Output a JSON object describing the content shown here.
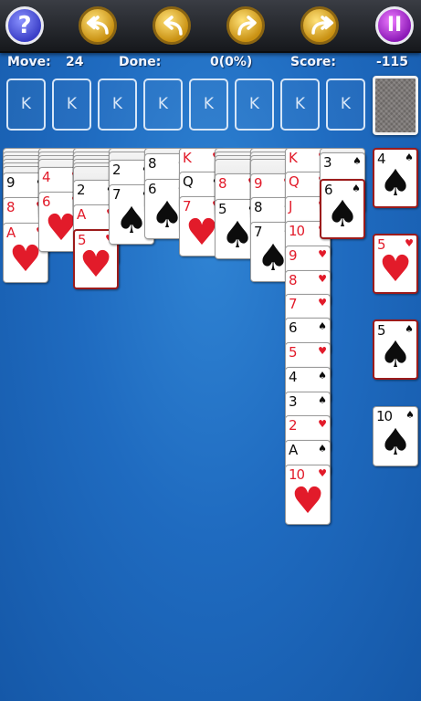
{
  "toolbar": {
    "help": "?",
    "pause": "II"
  },
  "status": {
    "move_label": "Move:",
    "move_value": "24",
    "done_label": "Done:",
    "done_value": "0(0%)",
    "score_label": "Score:",
    "score_value": "-115"
  },
  "foundation": [
    "K",
    "K",
    "K",
    "K",
    "K",
    "K",
    "K",
    "K"
  ],
  "cards": {
    "c0a": {
      "rank": "9",
      "suit": "♠"
    },
    "c0b": {
      "rank": "8",
      "suit": "♥"
    },
    "c0c": {
      "rank": "A",
      "suit": "♥"
    },
    "c1a": {
      "rank": "4",
      "suit": "♥"
    },
    "c1b": {
      "rank": "6",
      "suit": "♥"
    },
    "c2a": {
      "rank": "2",
      "suit": "♠"
    },
    "c2b": {
      "rank": "A",
      "suit": "♥"
    },
    "c2c": {
      "rank": "5",
      "suit": "♥"
    },
    "c3a": {
      "rank": "2",
      "suit": "♠"
    },
    "c3b": {
      "rank": "7",
      "suit": "♠"
    },
    "c4a": {
      "rank": "8",
      "suit": "♠"
    },
    "c4b": {
      "rank": "6",
      "suit": "♠"
    },
    "c5a": {
      "rank": "K",
      "suit": "♥"
    },
    "c5b": {
      "rank": "Q",
      "suit": "♠"
    },
    "c5c": {
      "rank": "7",
      "suit": "♥"
    },
    "c6a": {
      "rank": "8",
      "suit": "♥"
    },
    "c6b": {
      "rank": "5",
      "suit": "♠"
    },
    "c7a": {
      "rank": "9",
      "suit": "♥"
    },
    "c7b": {
      "rank": "8",
      "suit": "♠"
    },
    "c7c": {
      "rank": "7",
      "suit": "♠"
    },
    "c8a": {
      "rank": "K",
      "suit": "♥"
    },
    "c8b": {
      "rank": "Q",
      "suit": "♥"
    },
    "c8c": {
      "rank": "J",
      "suit": "♥"
    },
    "c8d": {
      "rank": "10",
      "suit": "♥"
    },
    "c8e": {
      "rank": "9",
      "suit": "♥"
    },
    "c8f": {
      "rank": "8",
      "suit": "♥"
    },
    "c8g": {
      "rank": "7",
      "suit": "♥"
    },
    "c8h": {
      "rank": "6",
      "suit": "♠"
    },
    "c8i": {
      "rank": "5",
      "suit": "♥"
    },
    "c8j": {
      "rank": "4",
      "suit": "♠"
    },
    "c8k": {
      "rank": "3",
      "suit": "♠"
    },
    "c8l": {
      "rank": "2",
      "suit": "♥"
    },
    "c8m": {
      "rank": "A",
      "suit": "♠"
    },
    "c8n": {
      "rank": "10",
      "suit": "♥"
    },
    "c9a": {
      "rank": "3",
      "suit": "♠"
    },
    "c9b": {
      "rank": "6",
      "suit": "♠"
    },
    "s1": {
      "rank": "4",
      "suit": "♠"
    },
    "s2": {
      "rank": "5",
      "suit": "♥"
    },
    "s3": {
      "rank": "5",
      "suit": "♠"
    },
    "s4": {
      "rank": "10",
      "suit": "♠"
    }
  },
  "colors": {
    "table_blue": "#1f6bc0",
    "red_suit": "#e21b2a",
    "black_suit": "#0c0c0c",
    "gold_button": "#e0ac2a",
    "help_button": "#4a4fd6",
    "pause_button": "#b23fd8"
  }
}
